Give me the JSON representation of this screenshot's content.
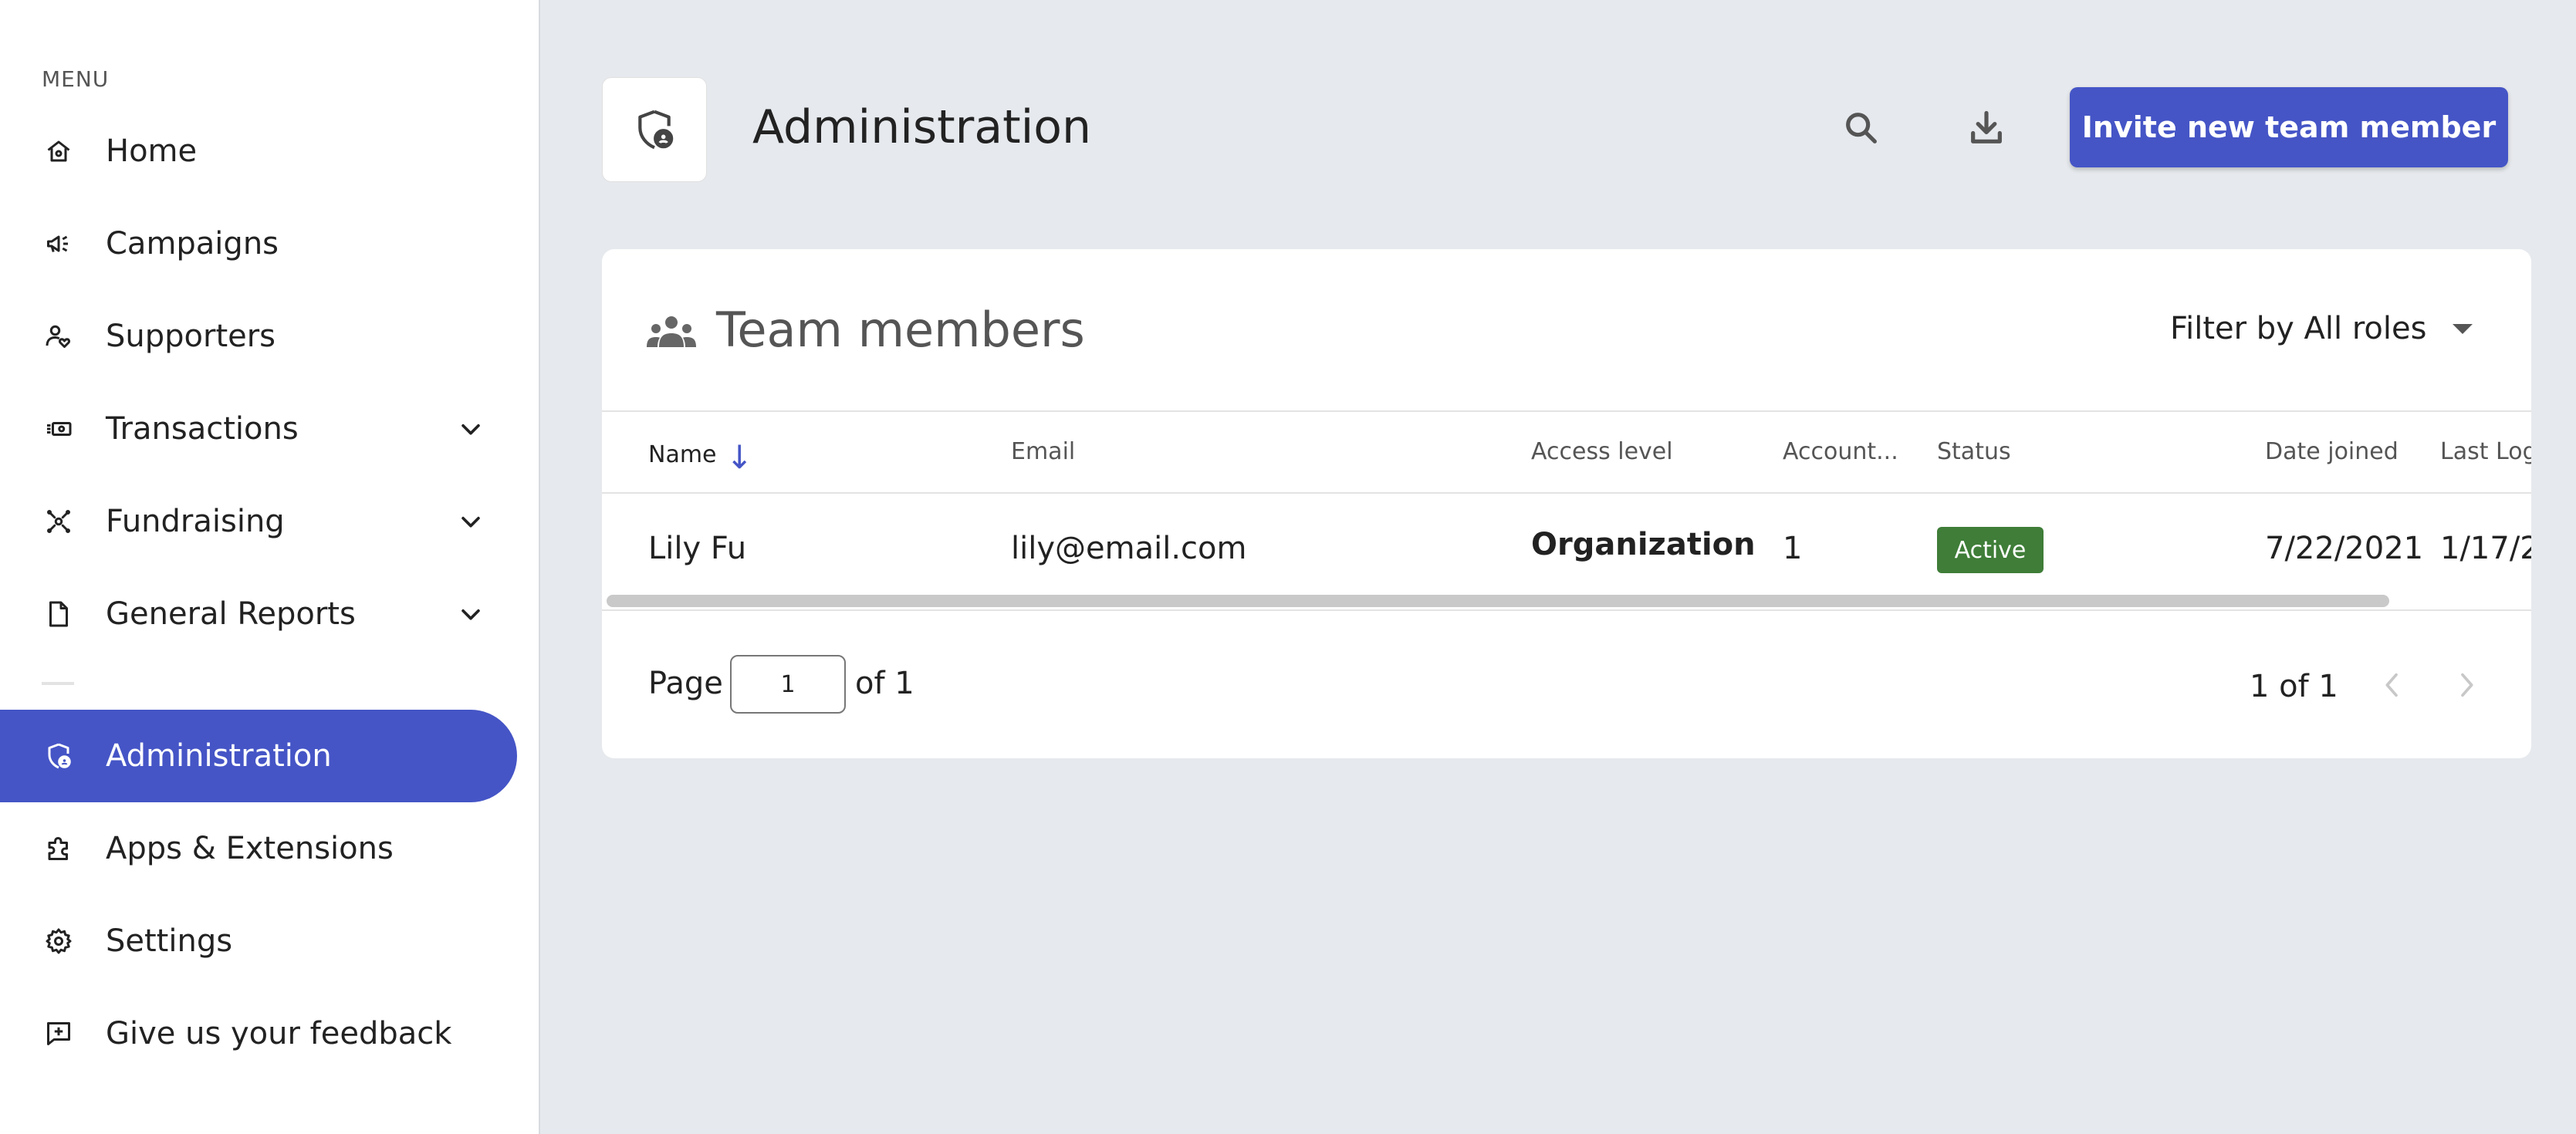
{
  "sidebar": {
    "menu_label": "MENU",
    "items": [
      {
        "label": "Home",
        "icon": "home-icon"
      },
      {
        "label": "Campaigns",
        "icon": "megaphone-icon"
      },
      {
        "label": "Supporters",
        "icon": "supporter-icon"
      },
      {
        "label": "Transactions",
        "icon": "cash-icon",
        "expandable": true
      },
      {
        "label": "Fundraising",
        "icon": "fundraising-icon",
        "expandable": true
      },
      {
        "label": "General Reports",
        "icon": "document-icon",
        "expandable": true
      },
      {
        "label": "Administration",
        "icon": "admin-shield-icon",
        "active": true
      },
      {
        "label": "Apps & Extensions",
        "icon": "puzzle-icon"
      },
      {
        "label": "Settings",
        "icon": "gear-icon"
      },
      {
        "label": "Give us your feedback",
        "icon": "feedback-icon"
      }
    ]
  },
  "header": {
    "title": "Administration",
    "invite_label": "Invite new team member",
    "icons": [
      "search-icon",
      "download-icon"
    ]
  },
  "team": {
    "title": "Team members",
    "filter_label": "Filter by All roles",
    "columns": [
      "Name",
      "Email",
      "Access level",
      "Account...",
      "Status",
      "Date joined",
      "Last Log"
    ],
    "rows": [
      {
        "name": "Lily Fu",
        "email": "lily@email.com",
        "access_level": "Organization only",
        "accounts": "1",
        "status": "Active",
        "date_joined": "7/22/2021",
        "last_login": "1/17/2"
      }
    ]
  },
  "pagination": {
    "page_label": "Page",
    "page_value": "1",
    "of_label": "of 1",
    "range": "1 of 1"
  },
  "colors": {
    "accent": "#4555c6",
    "status_active": "#3f7d38",
    "background": "#e6e9ed"
  }
}
